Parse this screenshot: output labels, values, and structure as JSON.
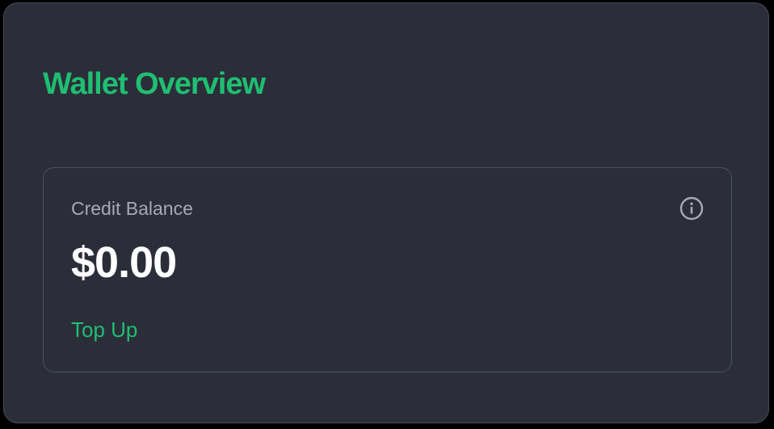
{
  "wallet": {
    "title": "Wallet Overview",
    "balance_card": {
      "label": "Credit Balance",
      "amount": "$0.00",
      "info_icon": "info-icon",
      "top_up_label": "Top Up"
    }
  },
  "colors": {
    "accent": "#1fbf72",
    "panel_background": "#2b2e39",
    "page_background": "#000000",
    "card_border": "#4a5263",
    "muted_text": "#a6aab4",
    "amount_text": "#ffffff"
  }
}
